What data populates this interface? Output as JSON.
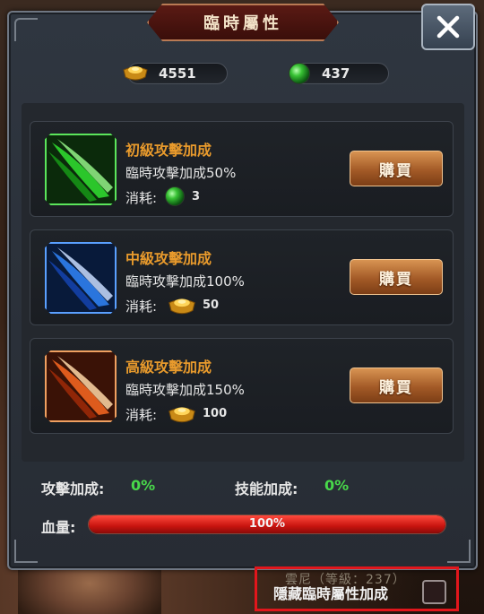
{
  "dialog": {
    "title": "臨時屬性",
    "close_label": "X"
  },
  "currency": {
    "gold": "4551",
    "gem": "437"
  },
  "items": [
    {
      "name": "初級攻擊加成",
      "desc": "臨時攻擊加成50%",
      "cost_label": "消耗:",
      "cost_value": "3",
      "cost_icon": "green-gem-icon",
      "buy_label": "購買",
      "color": "#2fd72f"
    },
    {
      "name": "中級攻擊加成",
      "desc": "臨時攻擊加成100%",
      "cost_label": "消耗:",
      "cost_value": "50",
      "cost_icon": "gold-ingot-icon",
      "buy_label": "購買",
      "color": "#2f7ff0"
    },
    {
      "name": "高級攻擊加成",
      "desc": "臨時攻擊加成150%",
      "cost_label": "消耗:",
      "cost_value": "100",
      "cost_icon": "gold-ingot-icon",
      "buy_label": "購買",
      "color": "#f06420"
    }
  ],
  "stats": {
    "attack_label": "攻擊加成:",
    "attack_value": "0%",
    "skill_label": "技能加成:",
    "skill_value": "0%"
  },
  "hp": {
    "label": "血量:",
    "text": "100%",
    "fraction": 1.0
  },
  "background": {
    "name_text": "雲尼（等級：237）"
  },
  "hide_option": {
    "label": "隱藏臨時屬性加成",
    "checked": false
  },
  "colors": {
    "accent_orange": "#e89a2c",
    "value_green": "#48d84a",
    "hp_red": "#d8160f",
    "highlight_red": "#e2161c"
  }
}
